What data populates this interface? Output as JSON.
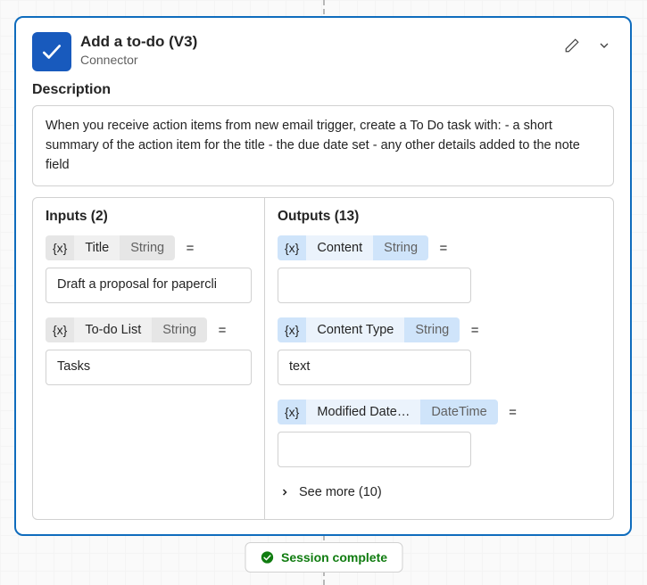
{
  "header": {
    "title": "Add a to-do (V3)",
    "subtitle": "Connector"
  },
  "description": {
    "label": "Description",
    "text": "When you receive action items from new email trigger, create a To Do task with: - a short summary of the action item for the title - the due date set - any other details added to the note field"
  },
  "inputs": {
    "header": "Inputs (2)",
    "items": [
      {
        "name": "Title",
        "type": "String",
        "value": "Draft a proposal for papercli"
      },
      {
        "name": "To-do List",
        "type": "String",
        "value": "Tasks"
      }
    ]
  },
  "outputs": {
    "header": "Outputs (13)",
    "items": [
      {
        "name": "Content",
        "type": "String",
        "value": ""
      },
      {
        "name": "Content Type",
        "type": "String",
        "value": "text"
      },
      {
        "name": "Modified Date…",
        "type": "DateTime",
        "value": ""
      }
    ],
    "see_more_label": "See more (10)"
  },
  "session": {
    "label": "Session complete"
  },
  "glyphs": {
    "var": "{x}",
    "eq": "="
  }
}
